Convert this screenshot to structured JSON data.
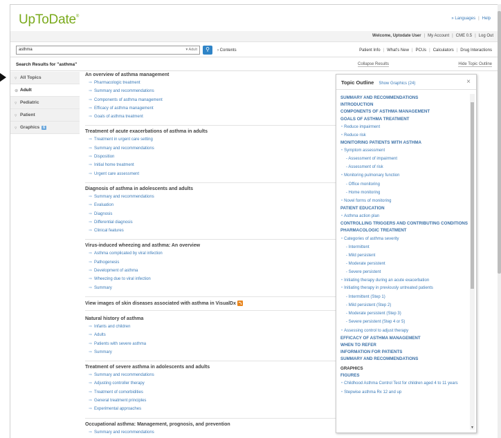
{
  "header": {
    "logo": "UpToDate",
    "logo_mark": "®",
    "languages": "Languages",
    "help": "Help",
    "welcome": "Welcome, Uptodate User",
    "my_account": "My Account",
    "cme": "CME 0.5",
    "logout": "Log Out"
  },
  "search": {
    "value": "asthma",
    "population": "Adult",
    "contents": "Contents"
  },
  "nav": [
    "Patient Info",
    "What's New",
    "PCUs",
    "Calculators",
    "Drug Interactions"
  ],
  "results_bar": {
    "label": "Search Results for \"asthma\"",
    "collapse": "Collapse Results",
    "hide_outline": "Hide Topic Outline"
  },
  "sidebar": {
    "items": [
      {
        "label": "All Topics"
      },
      {
        "label": "Adult"
      },
      {
        "label": "Pediatric"
      },
      {
        "label": "Patient"
      },
      {
        "label": "Graphics",
        "badge": "6"
      }
    ]
  },
  "topics": [
    {
      "title": "An overview of asthma management",
      "subs": [
        "Pharmacologic treatment",
        "Summary and recommendations",
        "Components of asthma management",
        "Efficacy of asthma management",
        "Goals of asthma treatment"
      ]
    },
    {
      "title": "Treatment of acute exacerbations of asthma in adults",
      "subs": [
        "Treatment in urgent care setting",
        "Summary and recommendations",
        "Disposition",
        "Initial home treatment",
        "Urgent care assessment"
      ]
    },
    {
      "title": "Diagnosis of asthma in adolescents and adults",
      "subs": [
        "Summary and recommendations",
        "Evaluation",
        "Diagnosis",
        "Differential diagnosis",
        "Clinical features"
      ]
    },
    {
      "title": "Virus-induced wheezing and asthma: An overview",
      "subs": [
        "Asthma complicated by viral infection",
        "Pathogenesis",
        "Development of asthma",
        "Wheezing due to viral infection",
        "Summary"
      ]
    },
    {
      "title": "Natural history of asthma",
      "subs": [
        "Infants and children",
        "Adults",
        "Patients with severe asthma",
        "Summary"
      ]
    },
    {
      "title": "Treatment of severe asthma in adolescents and adults",
      "subs": [
        "Summary and recommendations",
        "Adjusting controller therapy",
        "Treatment of comorbidities",
        "General treatment principles",
        "Experimental approaches"
      ]
    },
    {
      "title": "Occupational asthma: Management, prognosis, and prevention",
      "subs": [
        "Summary and recommendations"
      ]
    }
  ],
  "visualdx": "View images of skin diseases associated with asthma in VisualDx",
  "outline": {
    "title": "Topic Outline",
    "show_graphics": "Show Graphics (24)",
    "close": "×",
    "items": [
      {
        "t": "h",
        "text": "SUMMARY AND RECOMMENDATIONS"
      },
      {
        "t": "h",
        "text": "INTRODUCTION"
      },
      {
        "t": "h",
        "text": "COMPONENTS OF ASTHMA MANAGEMENT"
      },
      {
        "t": "h",
        "text": "GOALS OF ASTHMA TREATMENT"
      },
      {
        "t": "l1",
        "text": "Reduce impairment"
      },
      {
        "t": "l1",
        "text": "Reduce risk"
      },
      {
        "t": "h",
        "text": "MONITORING PATIENTS WITH ASTHMA"
      },
      {
        "t": "l1",
        "text": "Symptom assessment"
      },
      {
        "t": "l2",
        "text": "- Assessment of impairment"
      },
      {
        "t": "l2",
        "text": "- Assessment of risk"
      },
      {
        "t": "l1",
        "text": "Monitoring pulmonary function"
      },
      {
        "t": "l2",
        "text": "- Office monitoring"
      },
      {
        "t": "l2",
        "text": "- Home monitoring"
      },
      {
        "t": "l1",
        "text": "Novel forms of monitoring"
      },
      {
        "t": "h",
        "text": "PATIENT EDUCATION"
      },
      {
        "t": "l1",
        "text": "Asthma action plan"
      },
      {
        "t": "h",
        "text": "CONTROLLING TRIGGERS AND CONTRIBUTING CONDITIONS"
      },
      {
        "t": "h",
        "text": "PHARMACOLOGIC TREATMENT"
      },
      {
        "t": "l1",
        "text": "Categories of asthma severity"
      },
      {
        "t": "l2",
        "text": "- Intermittent"
      },
      {
        "t": "l2",
        "text": "- Mild persistent"
      },
      {
        "t": "l2",
        "text": "- Moderate persistent"
      },
      {
        "t": "l2",
        "text": "- Severe persistent"
      },
      {
        "t": "l1",
        "text": "Initiating therapy during an acute exacerbation"
      },
      {
        "t": "l1w",
        "text": "Initiating therapy in previously untreated patients"
      },
      {
        "t": "l2",
        "text": "- Intermittent (Step 1)"
      },
      {
        "t": "l2",
        "text": "- Mild persistent (Step 2)"
      },
      {
        "t": "l2",
        "text": "- Moderate persistent (Step 3)"
      },
      {
        "t": "l2",
        "text": "- Severe persistent (Step 4 or 5)"
      },
      {
        "t": "l1",
        "text": "Assessing control to adjust therapy"
      },
      {
        "t": "h",
        "text": "EFFICACY OF ASTHMA MANAGEMENT"
      },
      {
        "t": "h",
        "text": "WHEN TO REFER"
      },
      {
        "t": "h",
        "text": "INFORMATION FOR PATIENTS"
      },
      {
        "t": "h",
        "text": "SUMMARY AND RECOMMENDATIONS"
      },
      {
        "t": "g",
        "text": "GRAPHICS"
      },
      {
        "t": "h",
        "text": "FIGURES"
      },
      {
        "t": "l1w",
        "text": "Childhood Asthma Control Test for children aged 4 to 11 years"
      },
      {
        "t": "l1",
        "text": "Stepwise asthma Rx 12 and up"
      }
    ]
  },
  "colors": {
    "brand": "#7aaa1c",
    "link": "#3a7ab8",
    "search_button": "#2f84c7"
  }
}
